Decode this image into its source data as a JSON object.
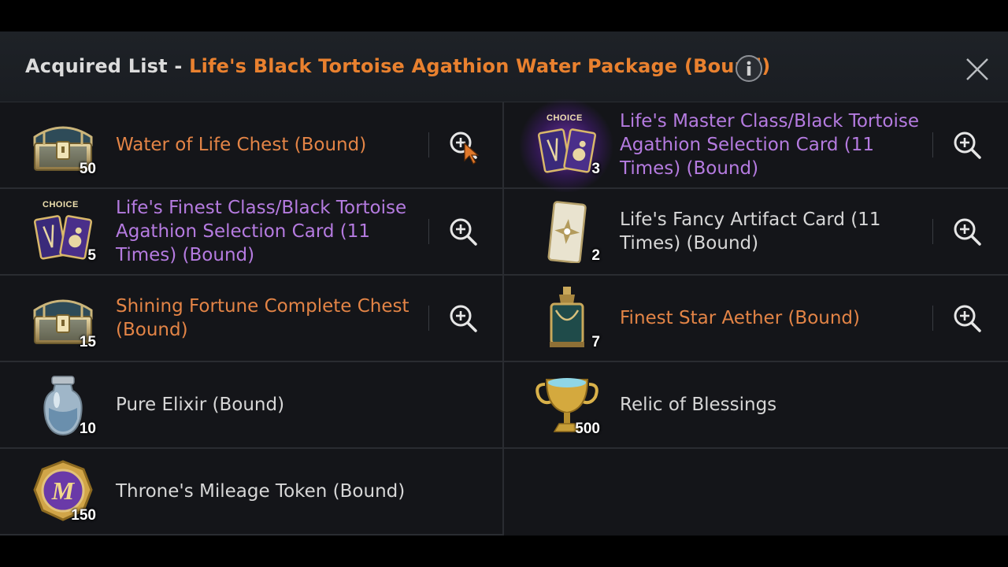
{
  "header": {
    "title_prefix": "Acquired List - ",
    "title_name": "Life's Black Tortoise Agathion Water Package (Bound)"
  },
  "items": [
    {
      "name_lines": [
        "Water of Life Chest (Bound)"
      ],
      "qty": "50",
      "color": "orange",
      "icon": "chest-icon",
      "zoom": true
    },
    {
      "name_lines": [
        "Life's Master Class/Black Tortoise",
        "Agathion Selection Card (11",
        "Times) (Bound)"
      ],
      "qty": "3",
      "color": "purple",
      "icon": "choice-card-icon",
      "zoom": true,
      "choice_label": "CHOICE",
      "glow": true
    },
    {
      "name_lines": [
        "Life's Finest Class/Black Tortoise",
        "Agathion Selection Card (11",
        "Times) (Bound)"
      ],
      "qty": "5",
      "color": "purple",
      "icon": "choice-card-icon",
      "zoom": true,
      "choice_label": "CHOICE"
    },
    {
      "name_lines": [
        "Life's Fancy Artifact Card (11",
        "Times) (Bound)"
      ],
      "qty": "2",
      "color": "white",
      "icon": "artifact-card-icon",
      "zoom": true
    },
    {
      "name_lines": [
        "Shining Fortune Complete Chest",
        "(Bound)"
      ],
      "qty": "15",
      "color": "orange",
      "icon": "chest-icon",
      "zoom": true
    },
    {
      "name_lines": [
        "Finest Star Aether (Bound)"
      ],
      "qty": "7",
      "color": "orange",
      "icon": "aether-bottle-icon",
      "zoom": true
    },
    {
      "name_lines": [
        "Pure Elixir (Bound)"
      ],
      "qty": "10",
      "color": "white",
      "icon": "elixir-icon",
      "zoom": false
    },
    {
      "name_lines": [
        "Relic of Blessings"
      ],
      "qty": "500",
      "color": "white",
      "icon": "trophy-icon",
      "zoom": false
    },
    {
      "name_lines": [
        "Throne's Mileage Token (Bound)"
      ],
      "qty": "150",
      "color": "white",
      "icon": "mileage-token-icon",
      "zoom": false,
      "token_letter": "M"
    }
  ],
  "colors": {
    "orange": "#e38446",
    "purple": "#b57be0",
    "white": "#d7d7d7",
    "title_accent": "#e9812f"
  }
}
